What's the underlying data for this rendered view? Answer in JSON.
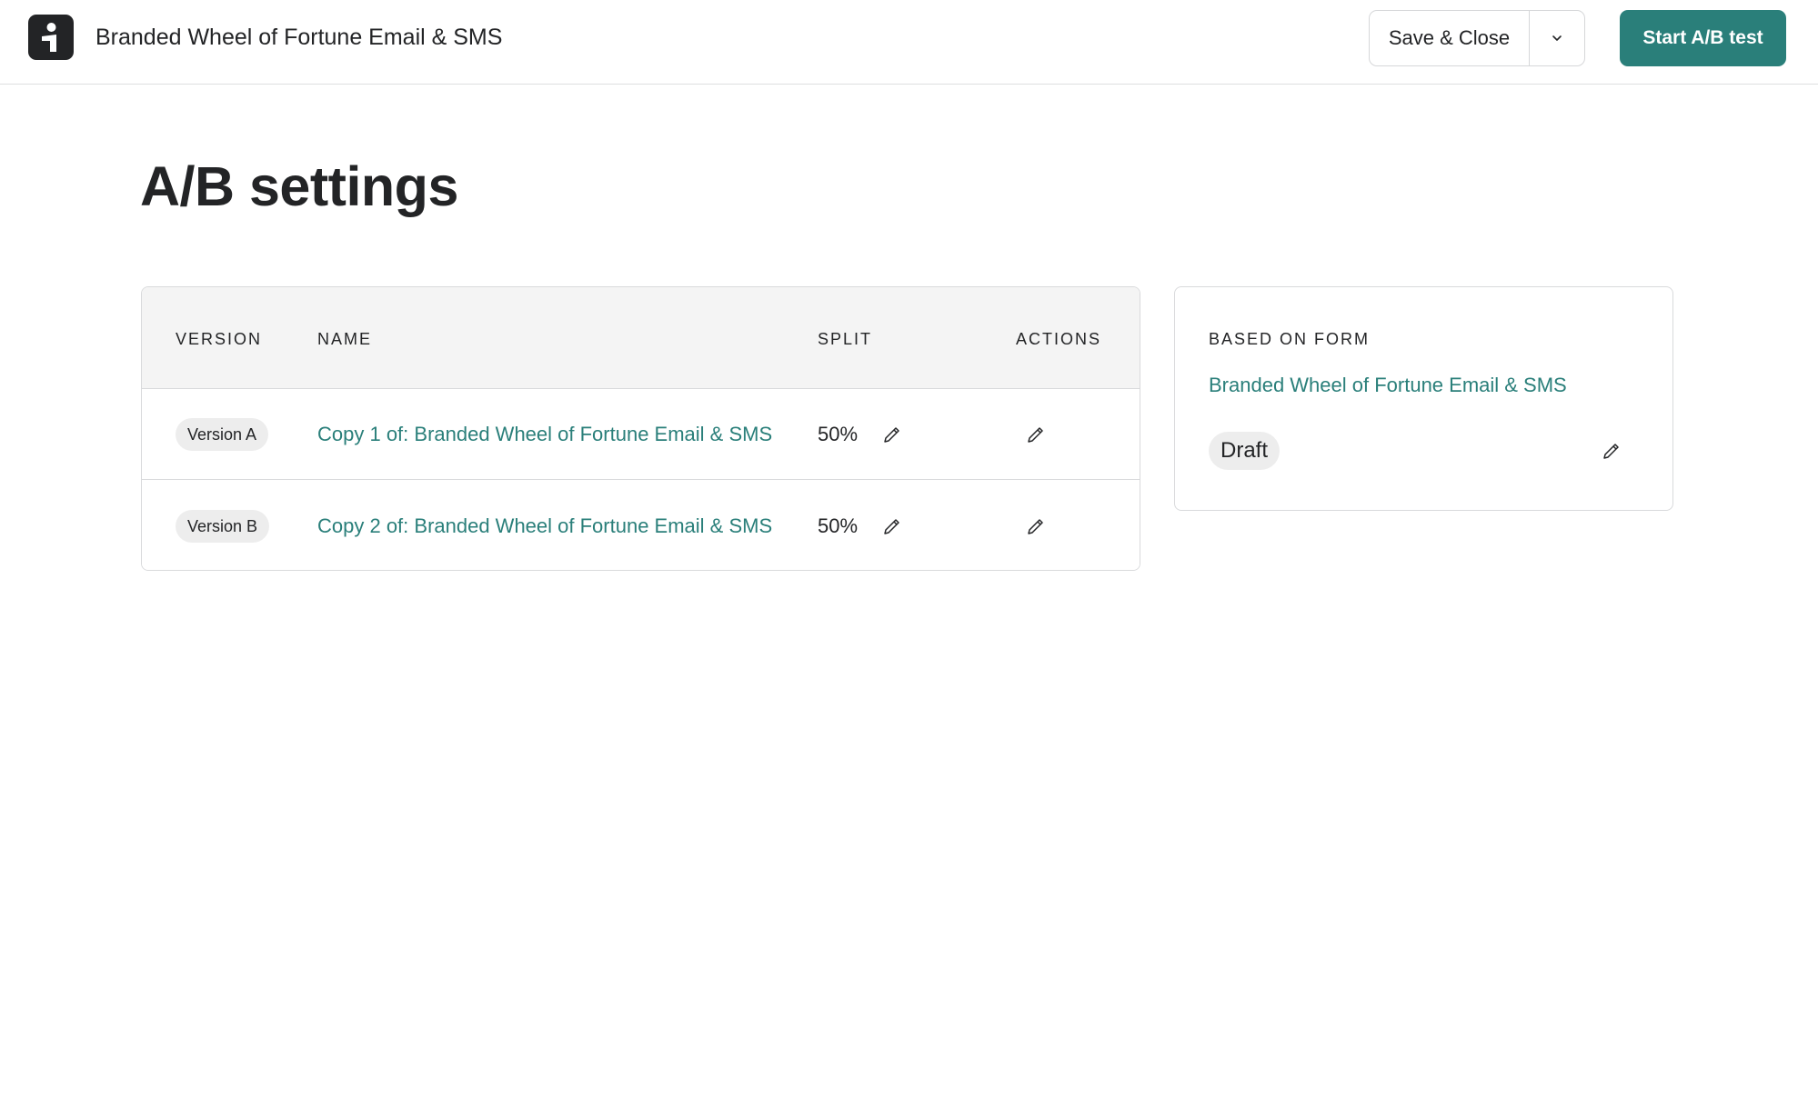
{
  "header": {
    "app_title": "Branded Wheel of Fortune Email & SMS",
    "save_close_label": "Save & Close",
    "start_test_label": "Start A/B test"
  },
  "page": {
    "title": "A/B settings"
  },
  "table": {
    "columns": [
      "VERSION",
      "NAME",
      "SPLIT",
      "ACTIONS"
    ],
    "rows": [
      {
        "version": "Version A",
        "name": "Copy 1 of: Branded Wheel of Fortune Email & SMS",
        "split": "50%"
      },
      {
        "version": "Version B",
        "name": "Copy 2 of: Branded Wheel of Fortune Email & SMS",
        "split": "50%"
      }
    ]
  },
  "based_on": {
    "label": "BASED ON FORM",
    "form_name": "Branded Wheel of Fortune Email & SMS",
    "status": "Draft"
  },
  "colors": {
    "accent": "#2a7f7a",
    "text": "#232426",
    "header_bg": "#f4f4f4",
    "pill_bg": "#ededed",
    "border": "#d9dadc"
  },
  "icons": {
    "logo": "brand-logo-icon",
    "caret": "chevron-down-icon",
    "edit": "pencil-icon"
  }
}
